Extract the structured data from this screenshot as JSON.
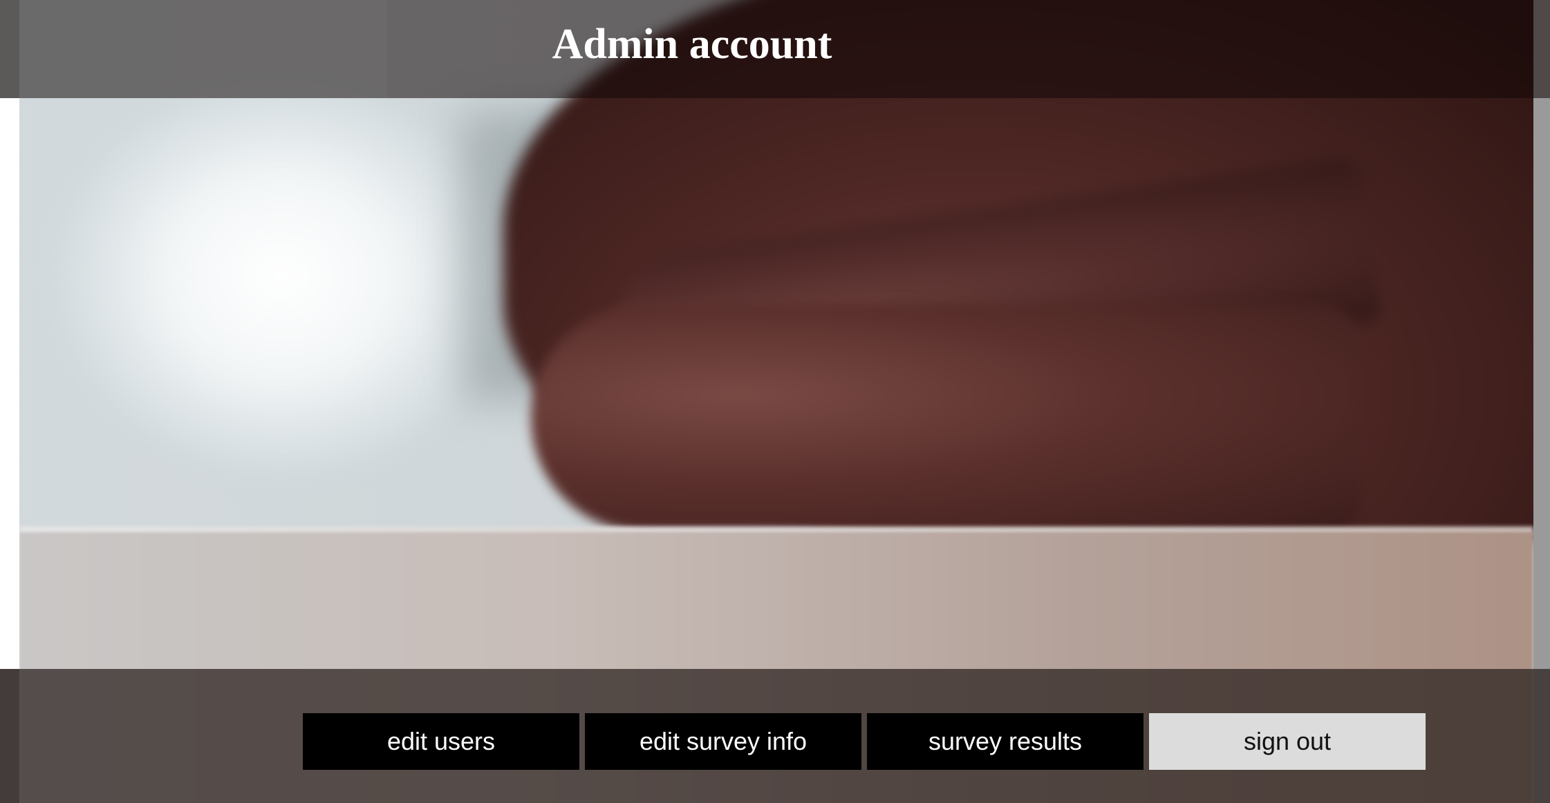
{
  "header": {
    "title": "Admin account"
  },
  "background": {
    "description_icon": "background-photo"
  },
  "nav": {
    "buttons": [
      {
        "label": "edit users",
        "style": "dark"
      },
      {
        "label": "edit survey info",
        "style": "dark"
      },
      {
        "label": "survey results",
        "style": "dark"
      },
      {
        "label": "sign out",
        "style": "light"
      }
    ]
  },
  "colors": {
    "button_dark": "#000000",
    "button_light": "#dcdcdc",
    "title_text": "#ffffff"
  }
}
